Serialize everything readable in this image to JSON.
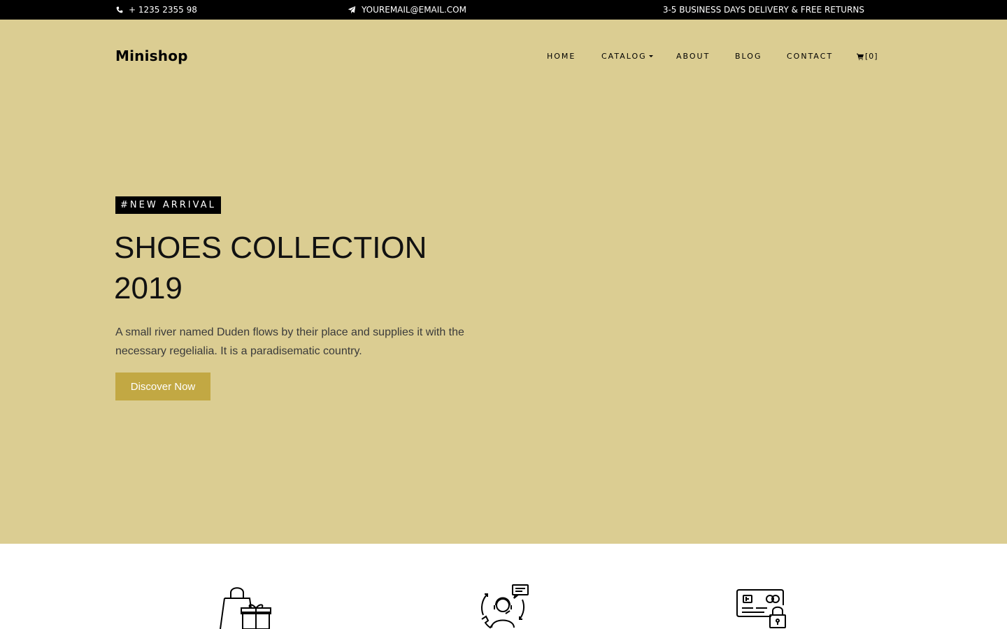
{
  "topbar": {
    "phone": "+ 1235 2355 98",
    "email": "YOUREMAIL@EMAIL.COM",
    "delivery": "3-5 BUSINESS DAYS DELIVERY & FREE RETURNS",
    "phone_icon": "phone-icon",
    "email_icon": "paper-plane-icon"
  },
  "header": {
    "brand": "Minishop"
  },
  "nav": {
    "items": [
      {
        "label": "HOME"
      },
      {
        "label": "CATALOG"
      },
      {
        "label": "ABOUT"
      },
      {
        "label": "BLOG"
      },
      {
        "label": "CONTACT"
      }
    ],
    "cart_count": "[0]",
    "cart_icon": "cart-icon"
  },
  "hero": {
    "badge": "#NEW ARRIVAL",
    "title_line1": "SHOES COLLECTION",
    "title_line2": "2019",
    "description": "A small river named Duden flows by their place and supplies it with the necessary regelialia. It is a paradisematic country.",
    "cta_label": "Discover Now"
  },
  "features": {
    "icons": [
      "shopping-bag-gift-icon",
      "customer-support-icon",
      "secure-credit-card-icon"
    ]
  },
  "colors": {
    "topbar_bg": "#000000",
    "hero_bg": "#dbcd92",
    "accent": "#c2a843",
    "text": "#000000"
  }
}
